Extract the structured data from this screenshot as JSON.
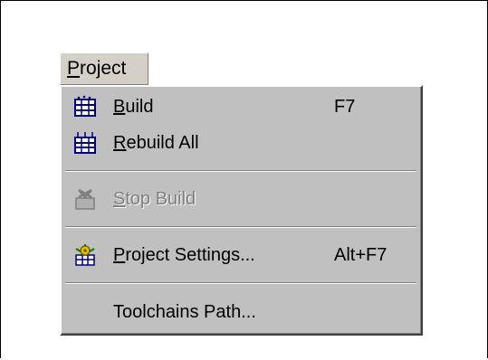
{
  "menubar": {
    "project_label_underlined": "P",
    "project_label_rest": "roject"
  },
  "menu": {
    "build": {
      "label_u": "B",
      "label_rest": "uild",
      "accel": "F7",
      "icon": "build-icon"
    },
    "rebuild_all": {
      "label_u": "R",
      "label_rest": "ebuild All",
      "icon": "rebuild-all-icon"
    },
    "stop_build": {
      "label_u": "S",
      "label_rest": "top Build",
      "icon": "stop-build-icon",
      "disabled": true
    },
    "project_settings": {
      "label_u": "P",
      "label_rest": "roject Settings...",
      "accel": "Alt+F7",
      "icon": "project-settings-icon"
    },
    "toolchains_path": {
      "label": "Toolchains Path..."
    }
  },
  "colors": {
    "menu_bg": "#c0c0c0",
    "disabled_text": "#808080"
  }
}
